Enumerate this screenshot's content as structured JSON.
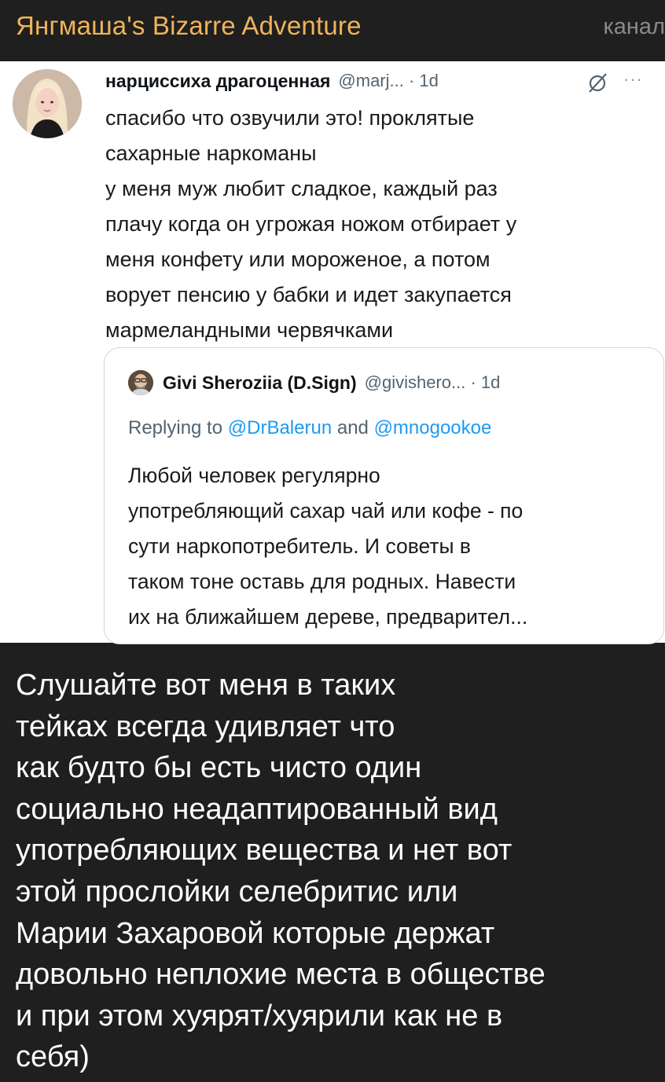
{
  "channel": {
    "name": "Янгмаша's Bizarre Adventure",
    "tag": "канал"
  },
  "tweet": {
    "author_name": "нарциссиха драгоценная",
    "handle_time": "@marj... · 1d",
    "body": "спасибо что озвучили это! проклятые\nсахарные наркоманы\nу меня муж любит сладкое, каждый раз\nплачу когда он угрожая ножом отбирает у\nменя конфету или мороженое, а потом\nворует пенсию у бабки и идет закупается\nмармеландными червячками",
    "icons": {
      "grok": "slashed-circle-icon",
      "more": "more-dots-icon"
    },
    "more_label": "···"
  },
  "quoted_tweet": {
    "author_name": "Givi Sheroziia (D.Sign)",
    "handle_time": "@givishero... · 1d",
    "replying_prefix": "Replying to ",
    "mention_1": "@DrBalerun",
    "replying_and": " and ",
    "mention_2": "@mnogookoe",
    "body": "Любой человек регулярно\nупотребляющий сахар чай или кофе - по\nсути наркопотребитель. И советы в\nтаком тоне оставь для родных. Навести\nих на ближайшем дереве, предварител..."
  },
  "message": {
    "text": "Слушайте вот меня в таких\nтейках всегда удивляет что\nкак будто бы есть чисто один\nсоциально неадаптированный вид\nупотребляющих вещества и нет вот\nэтой прослойки селебритис или\nМарии Захаровой которые держат\nдовольно неплохие места в обществе\nи при этом хуярят/хуярили как не в\nсебя)"
  },
  "colors": {
    "background": "#1f1f1f",
    "channel_name": "#f0b35a",
    "mention": "#1d9bf0",
    "secondary_text": "#536471"
  }
}
